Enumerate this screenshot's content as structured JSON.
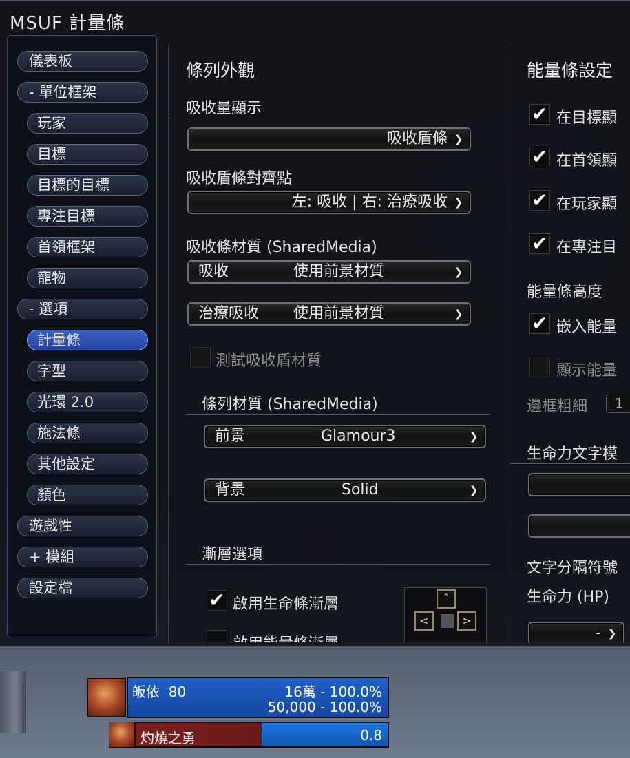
{
  "window": {
    "title": "MSUF 計量條"
  },
  "sidebar": {
    "items": [
      {
        "label": "儀表板",
        "level": 0,
        "active": false
      },
      {
        "label": "- 單位框架",
        "level": 0,
        "active": false
      },
      {
        "label": "玩家",
        "level": 1,
        "active": false
      },
      {
        "label": "目標",
        "level": 1,
        "active": false
      },
      {
        "label": "目標的目標",
        "level": 1,
        "active": false
      },
      {
        "label": "專注目標",
        "level": 1,
        "active": false
      },
      {
        "label": "首領框架",
        "level": 1,
        "active": false
      },
      {
        "label": "寵物",
        "level": 1,
        "active": false
      },
      {
        "label": "- 選項",
        "level": 0,
        "active": false
      },
      {
        "label": "計量條",
        "level": 1,
        "active": true
      },
      {
        "label": "字型",
        "level": 1,
        "active": false
      },
      {
        "label": "光環 2.0",
        "level": 1,
        "active": false
      },
      {
        "label": "施法條",
        "level": 1,
        "active": false
      },
      {
        "label": "其他設定",
        "level": 1,
        "active": false
      },
      {
        "label": "顏色",
        "level": 1,
        "active": false
      },
      {
        "label": "遊戲性",
        "level": 0,
        "active": false
      },
      {
        "label": "+ 模組",
        "level": 0,
        "active": false
      },
      {
        "label": "設定檔",
        "level": 0,
        "active": false
      }
    ]
  },
  "bar_appearance": {
    "heading": "條列外觀",
    "absorb_display_label": "吸收量顯示",
    "absorb_display_value": "吸收盾條",
    "absorb_anchor_label": "吸收盾條對齊點",
    "absorb_anchor_value": "左: 吸收 | 右: 治療吸收",
    "absorb_texture_label": "吸收條材質 (SharedMedia)",
    "absorb_texture": {
      "name": "吸收",
      "value": "使用前景材質"
    },
    "heal_absorb_texture": {
      "name": "治療吸收",
      "value": "使用前景材質"
    },
    "test_absorb_label": "測試吸收盾材質",
    "bar_texture_label": "條列材質 (SharedMedia)",
    "foreground": {
      "name": "前景",
      "value": "Glamour3"
    },
    "background": {
      "name": "背景",
      "value": "Solid"
    },
    "gradient_label": "漸層選項",
    "enable_hp_gradient": "啟用生命條漸層",
    "enable_power_gradient": "啟用能量條漸層"
  },
  "power_bar": {
    "heading": "能量條設定",
    "show_on_target": "在目標顯",
    "show_on_boss": "在首領顯",
    "show_on_player": "在玩家顯",
    "show_on_focus": "在專注目",
    "height_label": "能量條高度",
    "embed_label": "嵌入能量",
    "show_power_label": "顯示能量",
    "border_label": "邊框粗細",
    "border_value": "1",
    "hp_text_mode_label": "生命力文字模",
    "text_separator_label": "文字分隔符號",
    "hp_label": "生命力 (HP)",
    "hp_sep_value": "-"
  },
  "unit_frames": {
    "player_name": "皈依",
    "player_level": "80",
    "player_hp": "16萬 - 100.0%",
    "player_power": "50,000 - 100.0%",
    "pet_name": "灼燒之勇",
    "pet_value": "0.8"
  },
  "colors": {
    "accent": "#2b4fc0",
    "hp_bar": "#1e60c8",
    "pet_bar": "#7a1f1f"
  }
}
